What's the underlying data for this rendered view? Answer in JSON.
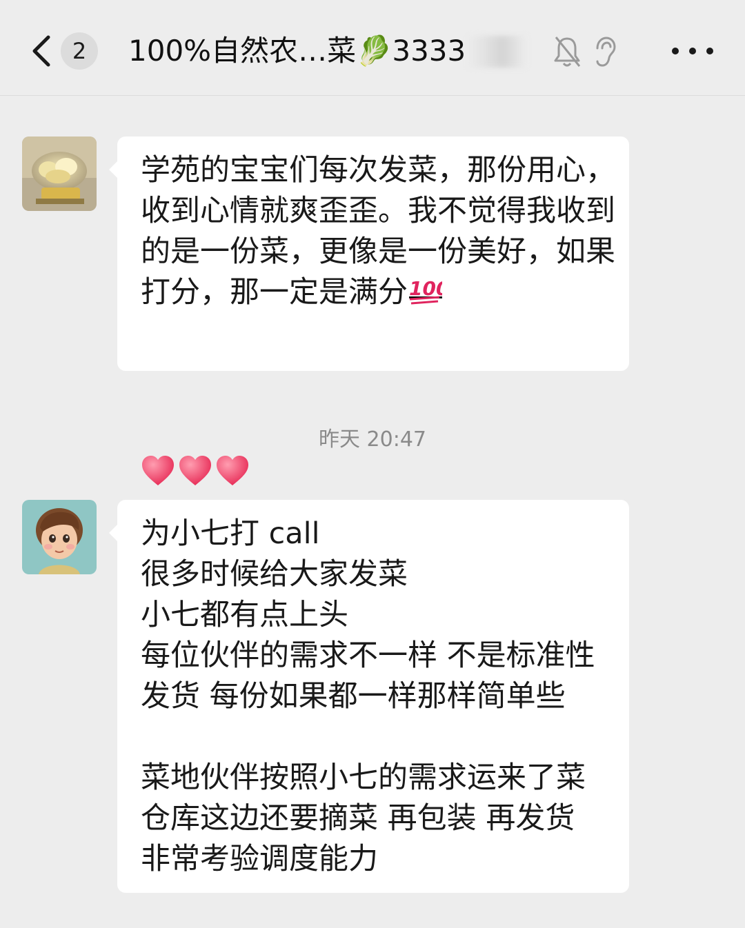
{
  "header": {
    "unread_count": "2",
    "title": "100%自然农…菜🥬3333",
    "icons": [
      "back-icon",
      "mute-bell-icon",
      "ear-icon",
      "more-icon"
    ]
  },
  "messages": [
    {
      "avatar": "jade-flower-avatar",
      "text": "学苑的宝宝们每次发菜，那份用心，收到心情就爽歪歪。我不觉得我收到的是一份菜，更像是一份美好，如果打分，那一定是满分",
      "emoji": "💯",
      "hearts": [
        "❤️",
        "❤️",
        "❤️"
      ]
    },
    {
      "avatar": "cartoon-girl-avatar",
      "lines": [
        "为小七打 call",
        "很多时候给大家发菜",
        "小七都有点上头",
        "每位伙伴的需求不一样 不是标准性",
        "发货 每份如果都一样那样简单些",
        "",
        "菜地伙伴按照小七的需求运来了菜",
        "仓库这边还要摘菜 再包装 再发货",
        "非常考验调度能力"
      ]
    }
  ],
  "timestamp": "昨天 20:47",
  "colors": {
    "background": "#ededed",
    "bubble": "#ffffff",
    "heart": "#f0406a",
    "timestamp": "#8a8a8a"
  }
}
